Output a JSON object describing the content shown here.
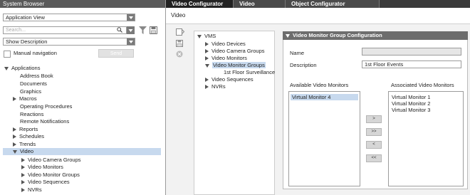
{
  "left": {
    "title": "System Browser",
    "view_select": "Application View",
    "search_placeholder": "Search...",
    "desc_select": "Show Description",
    "manual_nav": "Manual navigation",
    "send": "Send",
    "tree": {
      "applications": "Applications",
      "items": [
        "Address Book",
        "Documents",
        "Graphics",
        "Macros",
        "Operating Procedures",
        "Reactions",
        "Remote Notifications",
        "Reports",
        "Schedules",
        "Trends",
        "Video"
      ],
      "video_children": [
        "Video Camera Groups",
        "Video Monitors",
        "Video Monitor Groups",
        "Video Sequences",
        "NVRs"
      ]
    }
  },
  "tabs": [
    "Video Configurator",
    "Video",
    "Object Configurator"
  ],
  "subtitle": "Video",
  "tree2": {
    "root": "VMS",
    "items": [
      "Video Devices",
      "Video Camera Groups",
      "Video Monitors",
      "Video Monitor Groups",
      "1st Floor Surveillance",
      "Video Sequences",
      "NVRs"
    ]
  },
  "config": {
    "title": "Video Monitor Group Configuration",
    "name_label": "Name",
    "name_value": "",
    "desc_label": "Description",
    "desc_value": "1st Floor Events",
    "available_label": "Available Video Monitors",
    "associated_label": "Associated Video Monitors",
    "available": [
      "Virtual Monitor 4"
    ],
    "associated": [
      "Virtual Monitor 1",
      "Virtual Monitor 2",
      "Virtual Monitor 3"
    ],
    "buttons": [
      ">",
      ">>",
      "<",
      "<<"
    ]
  }
}
